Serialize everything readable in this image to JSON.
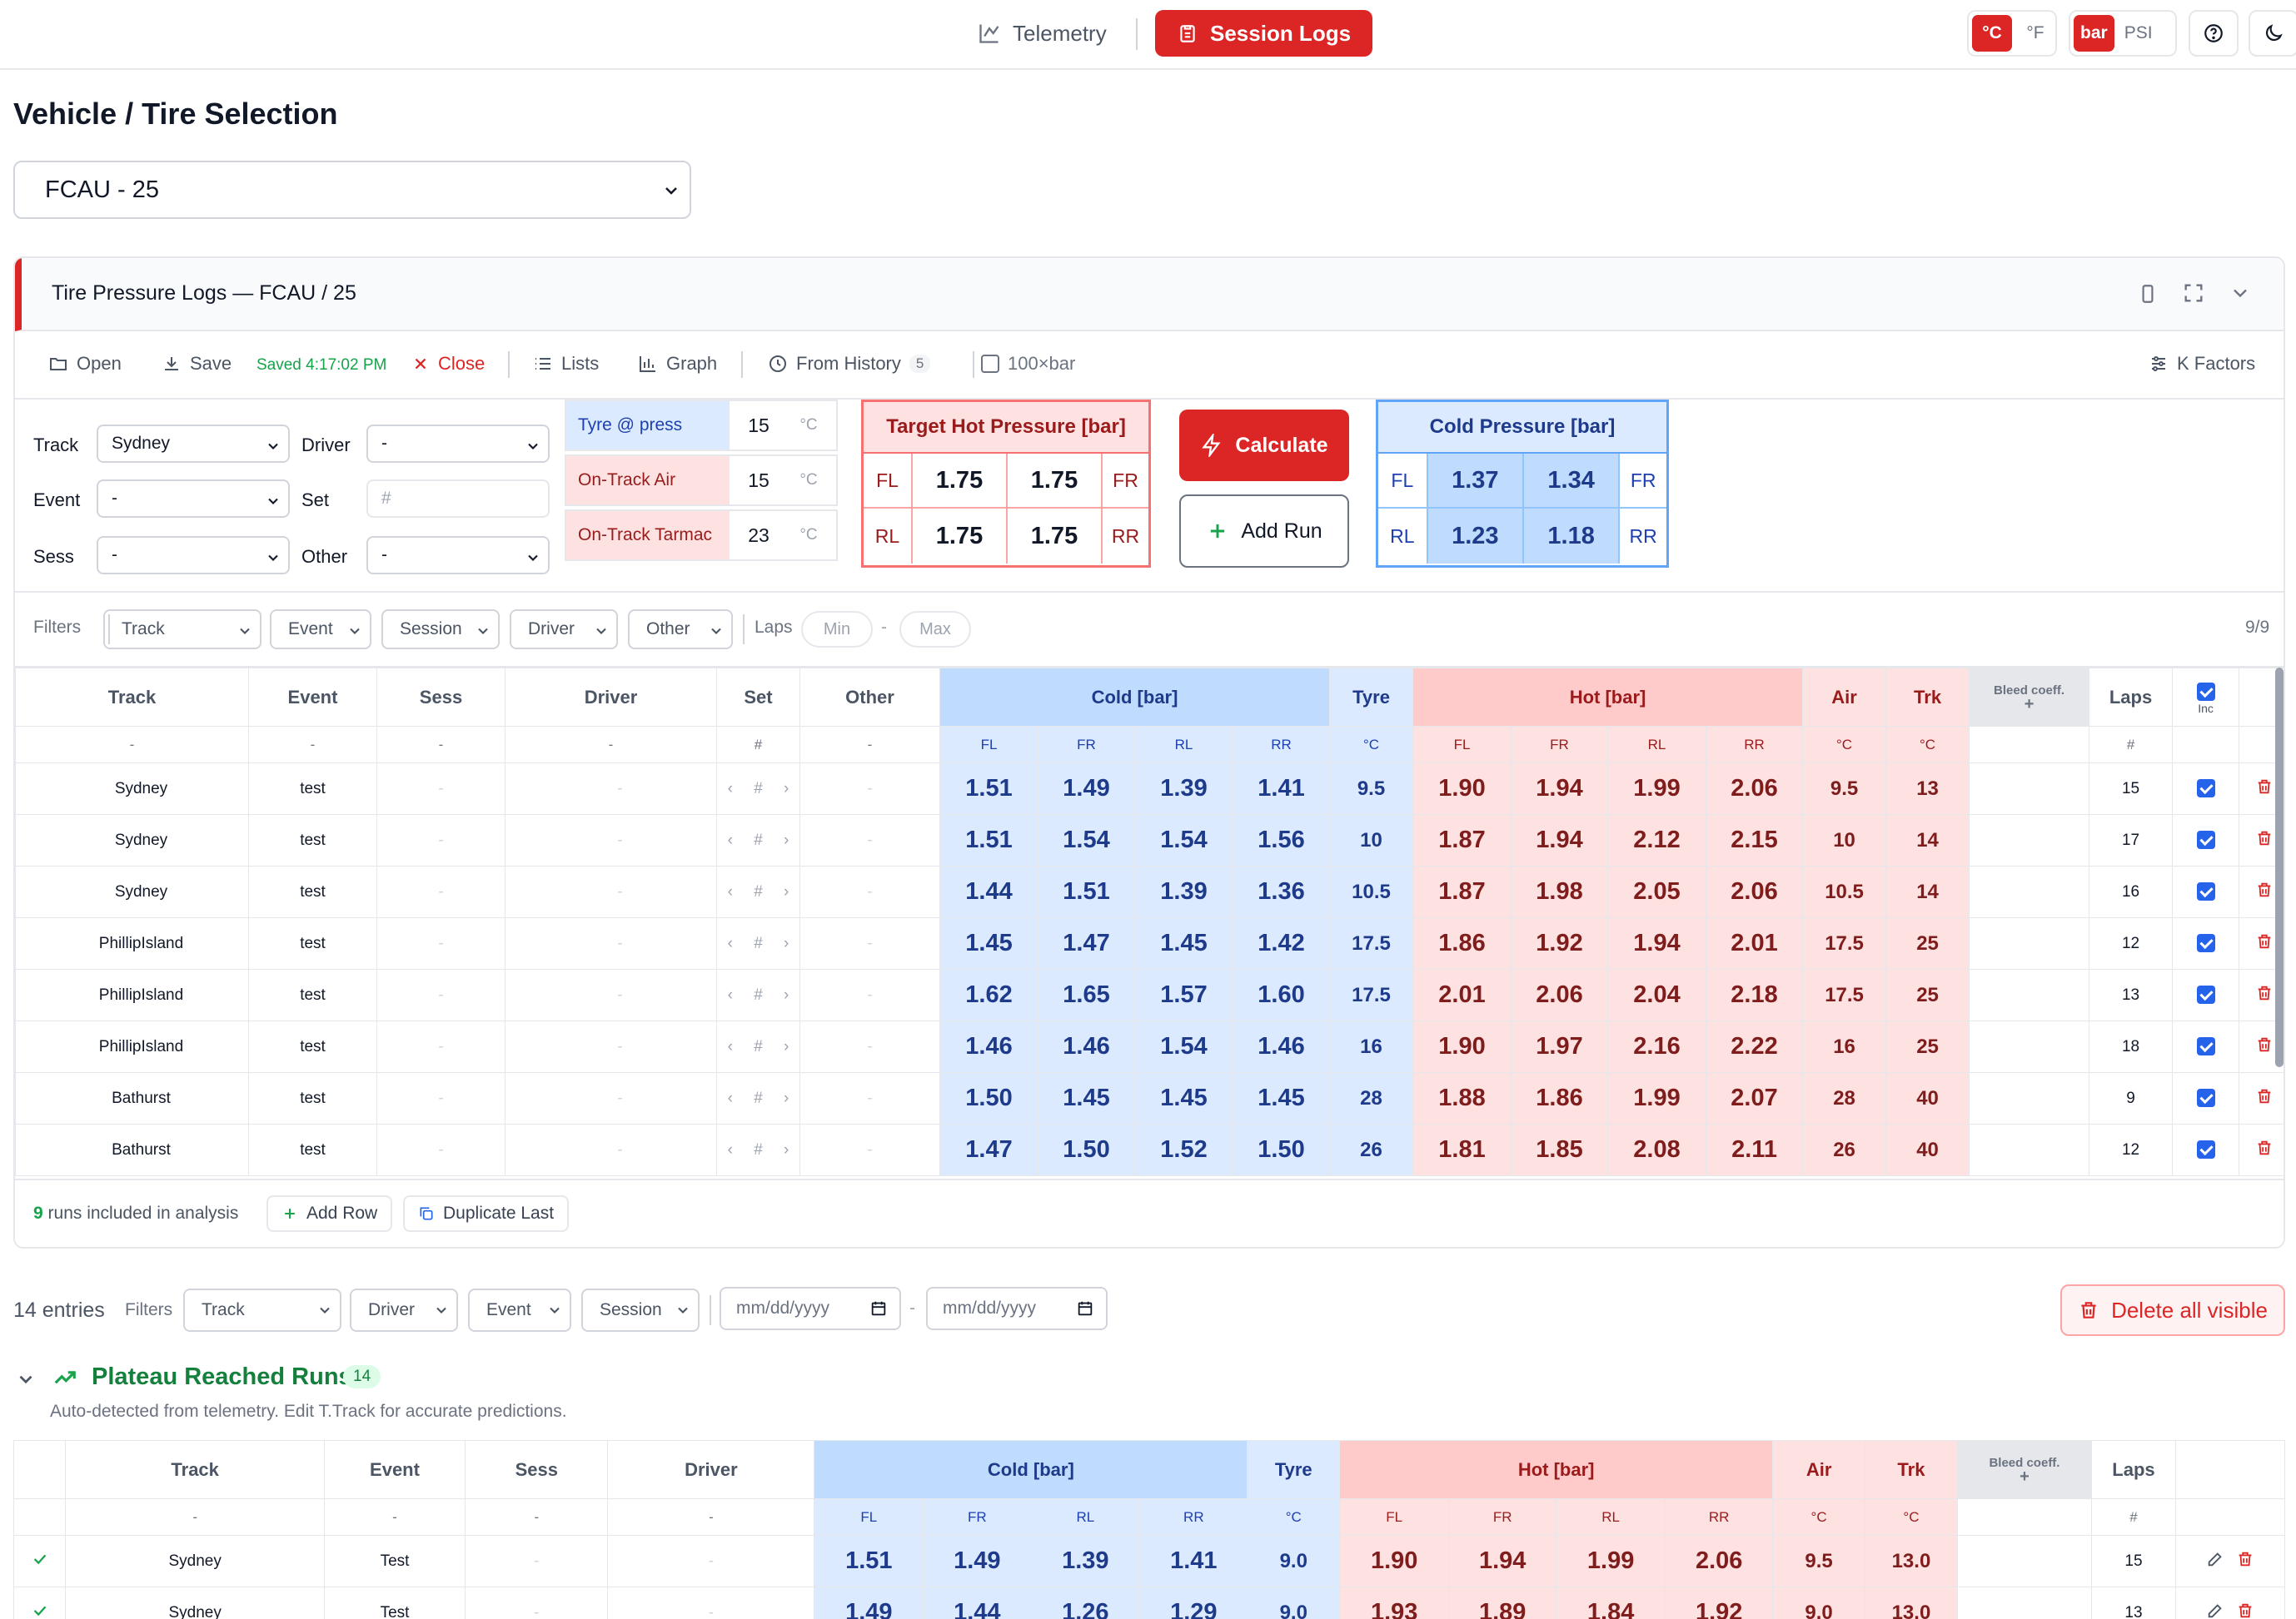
{
  "nav": {
    "telemetry": "Telemetry",
    "session_logs": "Session Logs",
    "temp_units": [
      "°C",
      "°F"
    ],
    "pressure_units": [
      "bar",
      "PSI"
    ]
  },
  "page": {
    "heading": "Vehicle / Tire Selection",
    "vehicle": "FCAU - 25"
  },
  "panel": {
    "title": "Tire Pressure Logs — FCAU / 25",
    "toolbar": {
      "open": "Open",
      "save": "Save",
      "saved": "Saved 4:17:02 PM",
      "close": "Close",
      "lists": "Lists",
      "graph": "Graph",
      "from_history": "From History",
      "history_count": "5",
      "bar100": "100×bar",
      "k_factors": "K Factors"
    },
    "setup": {
      "track_label": "Track",
      "track": "Sydney",
      "driver_label": "Driver",
      "driver": "-",
      "event_label": "Event",
      "event": "-",
      "set_label": "Set",
      "set_placeholder": "#",
      "sess_label": "Sess",
      "sess": "-",
      "other_label": "Other",
      "other": "-"
    },
    "conditions": [
      {
        "label": "Tyre @ press",
        "value": "15",
        "unit": "°C"
      },
      {
        "label": "On-Track Air",
        "value": "15",
        "unit": "°C"
      },
      {
        "label": "On-Track Tarmac",
        "value": "23",
        "unit": "°C"
      }
    ],
    "target_hot": {
      "title": "Target Hot Pressure [bar]",
      "FL_label": "FL",
      "FR_label": "FR",
      "RL_label": "RL",
      "RR_label": "RR",
      "FL": "1.75",
      "FR": "1.75",
      "RL": "1.75",
      "RR": "1.75"
    },
    "calculate": "Calculate",
    "add_run": "Add Run",
    "cold_result": {
      "title": "Cold Pressure [bar]",
      "FL": "1.37",
      "FR": "1.34",
      "RL": "1.23",
      "RR": "1.18"
    },
    "filters": {
      "label": "Filters",
      "track": "Track",
      "event": "Event",
      "session": "Session",
      "driver": "Driver",
      "other": "Other",
      "laps": "Laps",
      "min": "Min",
      "max": "Max",
      "dash": "-",
      "count": "9/9"
    },
    "table": {
      "headers": {
        "track": "Track",
        "event": "Event",
        "sess": "Sess",
        "driver": "Driver",
        "set": "Set",
        "other": "Other",
        "cold": "Cold [bar]",
        "tyre": "Tyre",
        "hot": "Hot [bar]",
        "air": "Air",
        "trk": "Trk",
        "bleed": "Bleed coeff.",
        "bleed_plus": "+",
        "laps": "Laps",
        "inc": "Inc"
      },
      "sub": {
        "dash": "-",
        "hash": "#",
        "FL": "FL",
        "FR": "FR",
        "RL": "RL",
        "RR": "RR",
        "c": "°C"
      },
      "rows": [
        {
          "track": "Sydney",
          "event": "test",
          "sess": "-",
          "driver": "-",
          "set": "#",
          "other": "-",
          "cfl": "1.51",
          "cfr": "1.49",
          "crl": "1.39",
          "crr": "1.41",
          "tyre": "9.5",
          "hfl": "1.90",
          "hfr": "1.94",
          "hrl": "1.99",
          "hrr": "2.06",
          "air": "9.5",
          "trk": "13",
          "laps": "15"
        },
        {
          "track": "Sydney",
          "event": "test",
          "sess": "-",
          "driver": "-",
          "set": "#",
          "other": "-",
          "cfl": "1.51",
          "cfr": "1.54",
          "crl": "1.54",
          "crr": "1.56",
          "tyre": "10",
          "hfl": "1.87",
          "hfr": "1.94",
          "hrl": "2.12",
          "hrr": "2.15",
          "air": "10",
          "trk": "14",
          "laps": "17"
        },
        {
          "track": "Sydney",
          "event": "test",
          "sess": "-",
          "driver": "-",
          "set": "#",
          "other": "-",
          "cfl": "1.44",
          "cfr": "1.51",
          "crl": "1.39",
          "crr": "1.36",
          "tyre": "10.5",
          "hfl": "1.87",
          "hfr": "1.98",
          "hrl": "2.05",
          "hrr": "2.06",
          "air": "10.5",
          "trk": "14",
          "laps": "16"
        },
        {
          "track": "PhillipIsland",
          "event": "test",
          "sess": "-",
          "driver": "-",
          "set": "#",
          "other": "-",
          "cfl": "1.45",
          "cfr": "1.47",
          "crl": "1.45",
          "crr": "1.42",
          "tyre": "17.5",
          "hfl": "1.86",
          "hfr": "1.92",
          "hrl": "1.94",
          "hrr": "2.01",
          "air": "17.5",
          "trk": "25",
          "laps": "12"
        },
        {
          "track": "PhillipIsland",
          "event": "test",
          "sess": "-",
          "driver": "-",
          "set": "#",
          "other": "-",
          "cfl": "1.62",
          "cfr": "1.65",
          "crl": "1.57",
          "crr": "1.60",
          "tyre": "17.5",
          "hfl": "2.01",
          "hfr": "2.06",
          "hrl": "2.04",
          "hrr": "2.18",
          "air": "17.5",
          "trk": "25",
          "laps": "13"
        },
        {
          "track": "PhillipIsland",
          "event": "test",
          "sess": "-",
          "driver": "-",
          "set": "#",
          "other": "-",
          "cfl": "1.46",
          "cfr": "1.46",
          "crl": "1.54",
          "crr": "1.46",
          "tyre": "16",
          "hfl": "1.90",
          "hfr": "1.97",
          "hrl": "2.16",
          "hrr": "2.22",
          "air": "16",
          "trk": "25",
          "laps": "18"
        },
        {
          "track": "Bathurst",
          "event": "test",
          "sess": "-",
          "driver": "-",
          "set": "#",
          "other": "-",
          "cfl": "1.50",
          "cfr": "1.45",
          "crl": "1.45",
          "crr": "1.45",
          "tyre": "28",
          "hfl": "1.88",
          "hfr": "1.86",
          "hrl": "1.99",
          "hrr": "2.07",
          "air": "28",
          "trk": "40",
          "laps": "9"
        },
        {
          "track": "Bathurst",
          "event": "test",
          "sess": "-",
          "driver": "-",
          "set": "#",
          "other": "-",
          "cfl": "1.47",
          "cfr": "1.50",
          "crl": "1.52",
          "crr": "1.50",
          "tyre": "26",
          "hfl": "1.81",
          "hfr": "1.85",
          "hrl": "2.08",
          "hrr": "2.11",
          "air": "26",
          "trk": "40",
          "laps": "12"
        }
      ]
    },
    "footer": {
      "count": "9",
      "runs_text": "runs included in analysis",
      "add_row": "Add Row",
      "duplicate_last": "Duplicate Last"
    }
  },
  "history": {
    "entries": "14 entries",
    "filters_label": "Filters",
    "track": "Track",
    "driver": "Driver",
    "event": "Event",
    "session": "Session",
    "date_placeholder": "mm/dd/yyyy",
    "date_sep": "-",
    "delete_visible": "Delete all visible",
    "plateau_title": "Plateau Reached Runs",
    "plateau_count": "14",
    "plateau_sub": "Auto-detected from telemetry. Edit T.Track for accurate predictions.",
    "rows": [
      {
        "track": "Sydney",
        "event": "Test",
        "sess": "-",
        "driver": "-",
        "cfl": "1.51",
        "cfr": "1.49",
        "crl": "1.39",
        "crr": "1.41",
        "tyre": "9.0",
        "hfl": "1.90",
        "hfr": "1.94",
        "hrl": "1.99",
        "hrr": "2.06",
        "air": "9.5",
        "trk": "13.0",
        "laps": "15"
      },
      {
        "track": "Sydney",
        "event": "Test",
        "sess": "-",
        "driver": "-",
        "cfl": "1.49",
        "cfr": "1.44",
        "crl": "1.26",
        "crr": "1.29",
        "tyre": "9.0",
        "hfl": "1.93",
        "hfr": "1.89",
        "hrl": "1.84",
        "hrr": "1.92",
        "air": "9.0",
        "trk": "13.0",
        "laps": "13"
      }
    ]
  },
  "colors": {
    "accent": "#dc2626",
    "cold": "#dbeafe",
    "hot": "#fee2e2",
    "success": "#16a34a"
  }
}
